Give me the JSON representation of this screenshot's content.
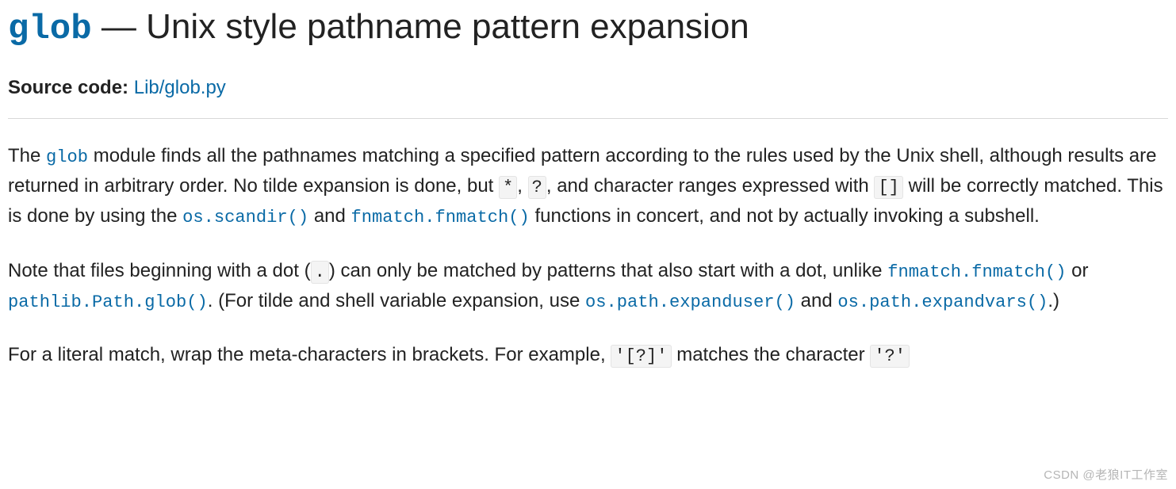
{
  "heading": {
    "module": "glob",
    "sep": " — ",
    "title": "Unix style pathname pattern expansion"
  },
  "source": {
    "label": "Source code:",
    "link_text": "Lib/glob.py"
  },
  "p1": {
    "t0": "The ",
    "glob": "glob",
    "t1": " module finds all the pathnames matching a specified pattern according to the rules used by the Unix shell, although results are returned in arbitrary order. No tilde expansion is done, but ",
    "star": "*",
    "t2": ", ",
    "qmark": "?",
    "t3": ", and character ranges expressed with ",
    "brackets": "[]",
    "t4": " will be correctly matched. This is done by using the ",
    "scandir": "os.scandir()",
    "t5": " and ",
    "fnmatch": "fnmatch.fnmatch()",
    "t6": " functions in concert, and not by actually invoking a subshell."
  },
  "p2": {
    "t0": "Note that files beginning with a dot (",
    "dot": ".",
    "t1": ") can only be matched by patterns that also start with a dot, unlike ",
    "fnmatch": "fnmatch.fnmatch()",
    "t2": " or ",
    "pathglob": "pathlib.Path.glob()",
    "t3": ". (For tilde and shell variable expansion, use ",
    "expanduser": "os.path.expanduser()",
    "t4": " and ",
    "expandvars": "os.path.expandvars()",
    "t5": ".)"
  },
  "p3": {
    "t0": "For a literal match, wrap the meta-characters in brackets. For example, ",
    "ex1": "'[?]'",
    "t1": " matches the character ",
    "ex2": "'?'"
  },
  "watermark": "CSDN @老狼IT工作室"
}
